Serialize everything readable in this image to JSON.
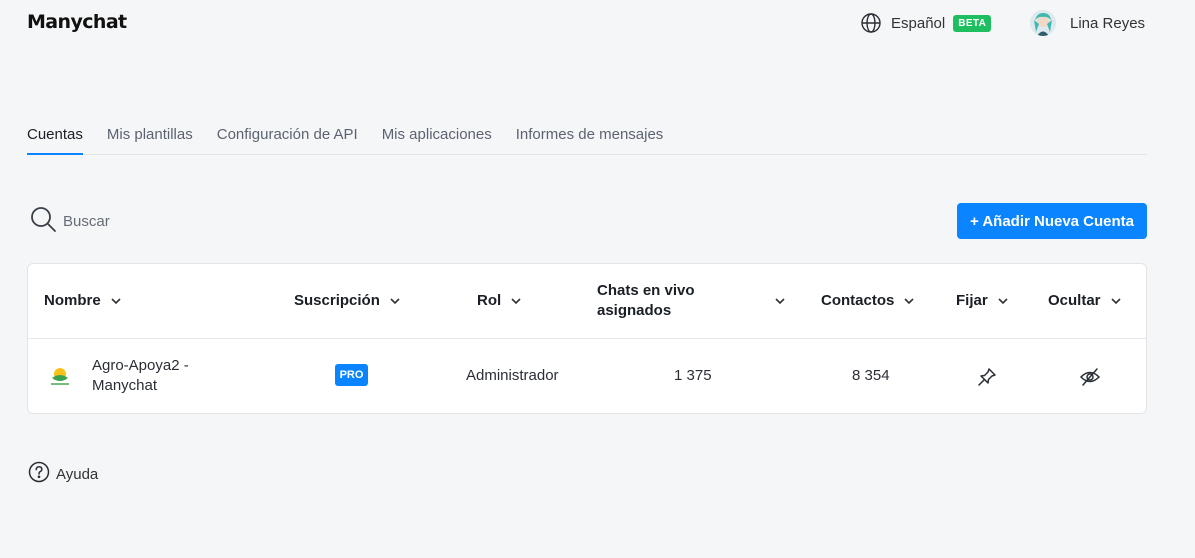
{
  "brand": {
    "logo_text": "Manychat"
  },
  "header": {
    "language": {
      "label": "Español",
      "badge": "BETA",
      "icon": "globe-icon"
    },
    "user": {
      "name": "Lina Reyes",
      "icon": "avatar"
    }
  },
  "tabs": [
    {
      "label": "Cuentas",
      "active": true
    },
    {
      "label": "Mis plantillas",
      "active": false
    },
    {
      "label": "Configuración de API",
      "active": false
    },
    {
      "label": "Mis aplicaciones",
      "active": false
    },
    {
      "label": "Informes de mensajes",
      "active": false
    }
  ],
  "search": {
    "placeholder": "Buscar",
    "icon": "search-icon"
  },
  "add_account_button": {
    "label": "+ Añadir Nueva Cuenta"
  },
  "table": {
    "columns": [
      {
        "label": "Nombre"
      },
      {
        "label": "Suscripción"
      },
      {
        "label": "Rol"
      },
      {
        "label": "Chats en vivo asignados"
      },
      {
        "label": "Contactos"
      },
      {
        "label": "Fijar"
      },
      {
        "label": "Ocultar"
      }
    ],
    "rows": [
      {
        "name_line1": "Agro-Apoya2 -",
        "name_line2": "Manychat",
        "subscription": "PRO",
        "role": "Administrador",
        "live_chats": "1 375",
        "contacts": "8 354",
        "pin_icon": "pin-icon",
        "hide_icon": "eye-off-icon"
      }
    ]
  },
  "help": {
    "label": "Ayuda",
    "icon": "help-circle-icon"
  },
  "colors": {
    "accent": "#0a84ff",
    "beta_badge": "#1fbf61",
    "background": "#f5f6f8"
  }
}
